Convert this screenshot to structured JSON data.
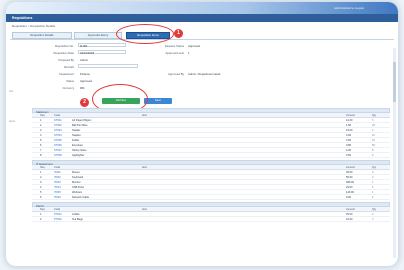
{
  "header": {
    "user_text": "Administrator ▸ Logout"
  },
  "title": "Requisitions",
  "breadcrumb": "Requisition > Requisition Details",
  "tabs": [
    {
      "label": "Requisition Details"
    },
    {
      "label": "Approval History"
    },
    {
      "label": "Requisition Items"
    }
  ],
  "markers": {
    "one": "1",
    "two": "2"
  },
  "form": {
    "fields": [
      {
        "label": "Requisition No.",
        "value": "R-001"
      },
      {
        "label": "Requisition Date",
        "value": "24/01/2018"
      },
      {
        "label": "Prepared By",
        "value": "Admin"
      },
      {
        "label": "Remark",
        "value": ""
      },
      {
        "label": "Department",
        "value": "Finance"
      },
      {
        "label": "Status",
        "value": "Approved"
      },
      {
        "label": "Currency",
        "value": "RM"
      },
      {
        "label": "Attachment",
        "value": ""
      }
    ],
    "side_fields": [
      {
        "label": "Request Status",
        "value": "Approved"
      },
      {
        "label": "Approval Level",
        "value": "1"
      },
      {
        "label": "Approved By",
        "value": "Admin / Department Head"
      }
    ]
  },
  "buttons": {
    "add_item": "Add Item",
    "save": "Save"
  },
  "left_markers": [
    "Info",
    "Items"
  ],
  "sections": [
    {
      "title": "Stationery",
      "headers": {
        "seq": "Seq",
        "code": "Code",
        "name": "Item",
        "amt": "Amount",
        "tag": "Qty"
      },
      "rows": [
        {
          "seq": "1",
          "code": "ST001",
          "name": "A4 Paper 80gsm",
          "amt": "12.00",
          "tag": "5"
        },
        {
          "seq": "2",
          "code": "ST002",
          "name": "Ball Pen Blue",
          "amt": "1.50",
          "tag": "20"
        },
        {
          "seq": "3",
          "code": "ST003",
          "name": "Stapler",
          "amt": "15.00",
          "tag": "2"
        },
        {
          "seq": "4",
          "code": "ST004",
          "name": "Staples",
          "amt": "3.00",
          "tag": "10"
        },
        {
          "seq": "5",
          "code": "ST005",
          "name": "Folder",
          "amt": "2.50",
          "tag": "15"
        },
        {
          "seq": "6",
          "code": "ST006",
          "name": "Envelope",
          "amt": "0.80",
          "tag": "50"
        },
        {
          "seq": "7",
          "code": "ST007",
          "name": "Sticky Notes",
          "amt": "4.00",
          "tag": "8"
        },
        {
          "seq": "8",
          "code": "ST008",
          "name": "Highlighter",
          "amt": "3.50",
          "tag": "6"
        }
      ]
    },
    {
      "title": "IT Equipment",
      "headers": {
        "seq": "Seq",
        "code": "Code",
        "name": "Item",
        "amt": "Amount",
        "tag": "Qty"
      },
      "rows": [
        {
          "seq": "1",
          "code": "IT001",
          "name": "Mouse",
          "amt": "35.00",
          "tag": "3"
        },
        {
          "seq": "2",
          "code": "IT002",
          "name": "Keyboard",
          "amt": "55.00",
          "tag": "3"
        },
        {
          "seq": "3",
          "code": "IT003",
          "name": "Monitor",
          "amt": "480.00",
          "tag": "1"
        },
        {
          "seq": "4",
          "code": "IT004",
          "name": "USB Drive",
          "amt": "29.00",
          "tag": "4"
        },
        {
          "seq": "5",
          "code": "IT005",
          "name": "Webcam",
          "amt": "120.00",
          "tag": "1"
        },
        {
          "seq": "6",
          "code": "IT006",
          "name": "Network Cable",
          "amt": "9.00",
          "tag": "6"
        }
      ]
    },
    {
      "title": "Pantry",
      "headers": {
        "seq": "Seq",
        "code": "Code",
        "name": "Item",
        "amt": "Amount",
        "tag": "Qty"
      },
      "rows": [
        {
          "seq": "1",
          "code": "PT001",
          "name": "Coffee",
          "amt": "25.00",
          "tag": "2"
        },
        {
          "seq": "2",
          "code": "PT002",
          "name": "Tea Bags",
          "amt": "10.00",
          "tag": "3"
        }
      ]
    }
  ]
}
